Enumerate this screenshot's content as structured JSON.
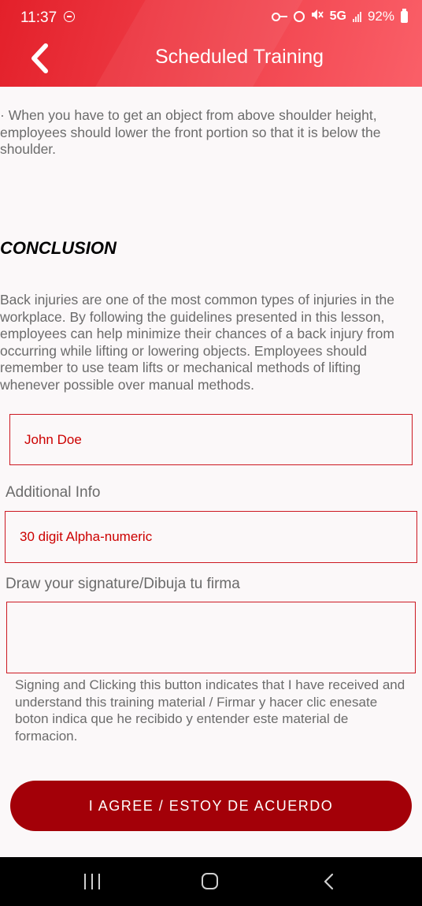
{
  "status_bar": {
    "time": "11:37",
    "network": "5G",
    "battery": "92%"
  },
  "header": {
    "title": "Scheduled Training"
  },
  "content": {
    "intro_text": "· When you have to get an object from above shoulder height, employees should lower the front portion so that it is below the shoulder.",
    "conclusion_heading": "CONCLUSION",
    "conclusion_text": "Back injuries are one of the most common types of injuries in the workplace. By following the guidelines presented in this lesson, employees can help minimize their chances of a back injury from occurring while lifting or lowering objects. Employees should remember to use team lifts or mechanical methods of lifting whenever possible over manual methods."
  },
  "form": {
    "name_value": "John Doe",
    "additional_info_label": "Additional Info",
    "additional_info_placeholder": "30 digit Alpha-numeric",
    "signature_label": "Draw your signature/Dibuja tu firma",
    "disclaimer": "Signing and Clicking this button indicates that I have received and understand this training material / Firmar y hacer clic enesate boton indica que he recibido y entender este material de formacion.",
    "agree_button": "I AGREE / ESTOY DE ACUERDO"
  },
  "colors": {
    "header_gradient_start": "#e3202a",
    "header_gradient_end": "#fa5f68",
    "accent_red": "#cc1822",
    "button_dark_red": "#a30008"
  },
  "icons": [
    "back-chevron-icon",
    "recent-apps-icon",
    "home-icon",
    "nav-back-icon"
  ]
}
